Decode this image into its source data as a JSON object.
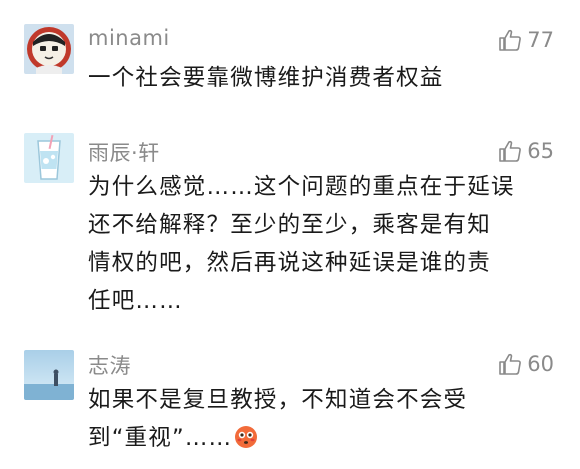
{
  "comments": [
    {
      "username": "minami",
      "likes": "77",
      "lines": [
        "一个社会要靠微博维护消费者权益"
      ]
    },
    {
      "username": "雨辰·轩",
      "likes": "65",
      "lines": [
        "为什么感觉……这个问题的重点在于延误",
        "还不给解释？至少的至少，乘客是有知",
        "情权的吧，然后再说这种延误是谁的责",
        "任吧……"
      ]
    },
    {
      "username": "志涛",
      "likes": "60",
      "lines": [
        "如果不是复旦教授，不知道会不会受",
        "到“重视”……"
      ],
      "emoji": "flushed-face-icon"
    }
  ],
  "colors": {
    "text": "#1a1a1a",
    "meta": "#8a8a8a",
    "background": "#ffffff"
  }
}
